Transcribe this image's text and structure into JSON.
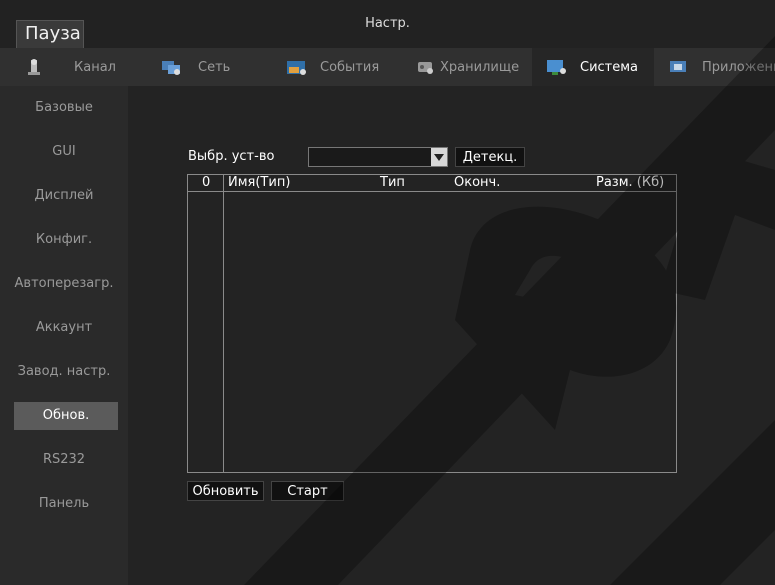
{
  "window": {
    "title": "Настр.",
    "pause_tab": "Пауза"
  },
  "tabs": [
    {
      "label": "Канал",
      "icon": "channel-icon"
    },
    {
      "label": "Сеть",
      "icon": "network-icon"
    },
    {
      "label": "События",
      "icon": "events-icon"
    },
    {
      "label": "Хранилище",
      "icon": "storage-icon"
    },
    {
      "label": "Система",
      "icon": "system-icon",
      "active": true
    },
    {
      "label": "Приложени",
      "icon": "apps-icon"
    }
  ],
  "sidebar": {
    "items": [
      {
        "label": "Базовые"
      },
      {
        "label": "GUI"
      },
      {
        "label": "Дисплей"
      },
      {
        "label": "Конфиг."
      },
      {
        "label": "Автоперезагр."
      },
      {
        "label": "Аккаунт"
      },
      {
        "label": "Завод. настр."
      },
      {
        "label": "Обнов.",
        "active": true
      },
      {
        "label": "RS232"
      },
      {
        "label": "Панель"
      }
    ]
  },
  "upgrade": {
    "select_device_label": "Выбр. уст-во",
    "device_value": "",
    "detect_button": "Детекц.",
    "table": {
      "columns": [
        "0",
        "Имя(Тип)",
        "Тип",
        "Оконч.",
        "Разм. (Кб)"
      ],
      "rows": []
    },
    "refresh_button": "Обновить",
    "start_button": "Старт"
  },
  "colors": {
    "background": "#1c1c1c",
    "panel": "#232323",
    "active_side": "#5b5b5b",
    "watermark": "#000000"
  }
}
